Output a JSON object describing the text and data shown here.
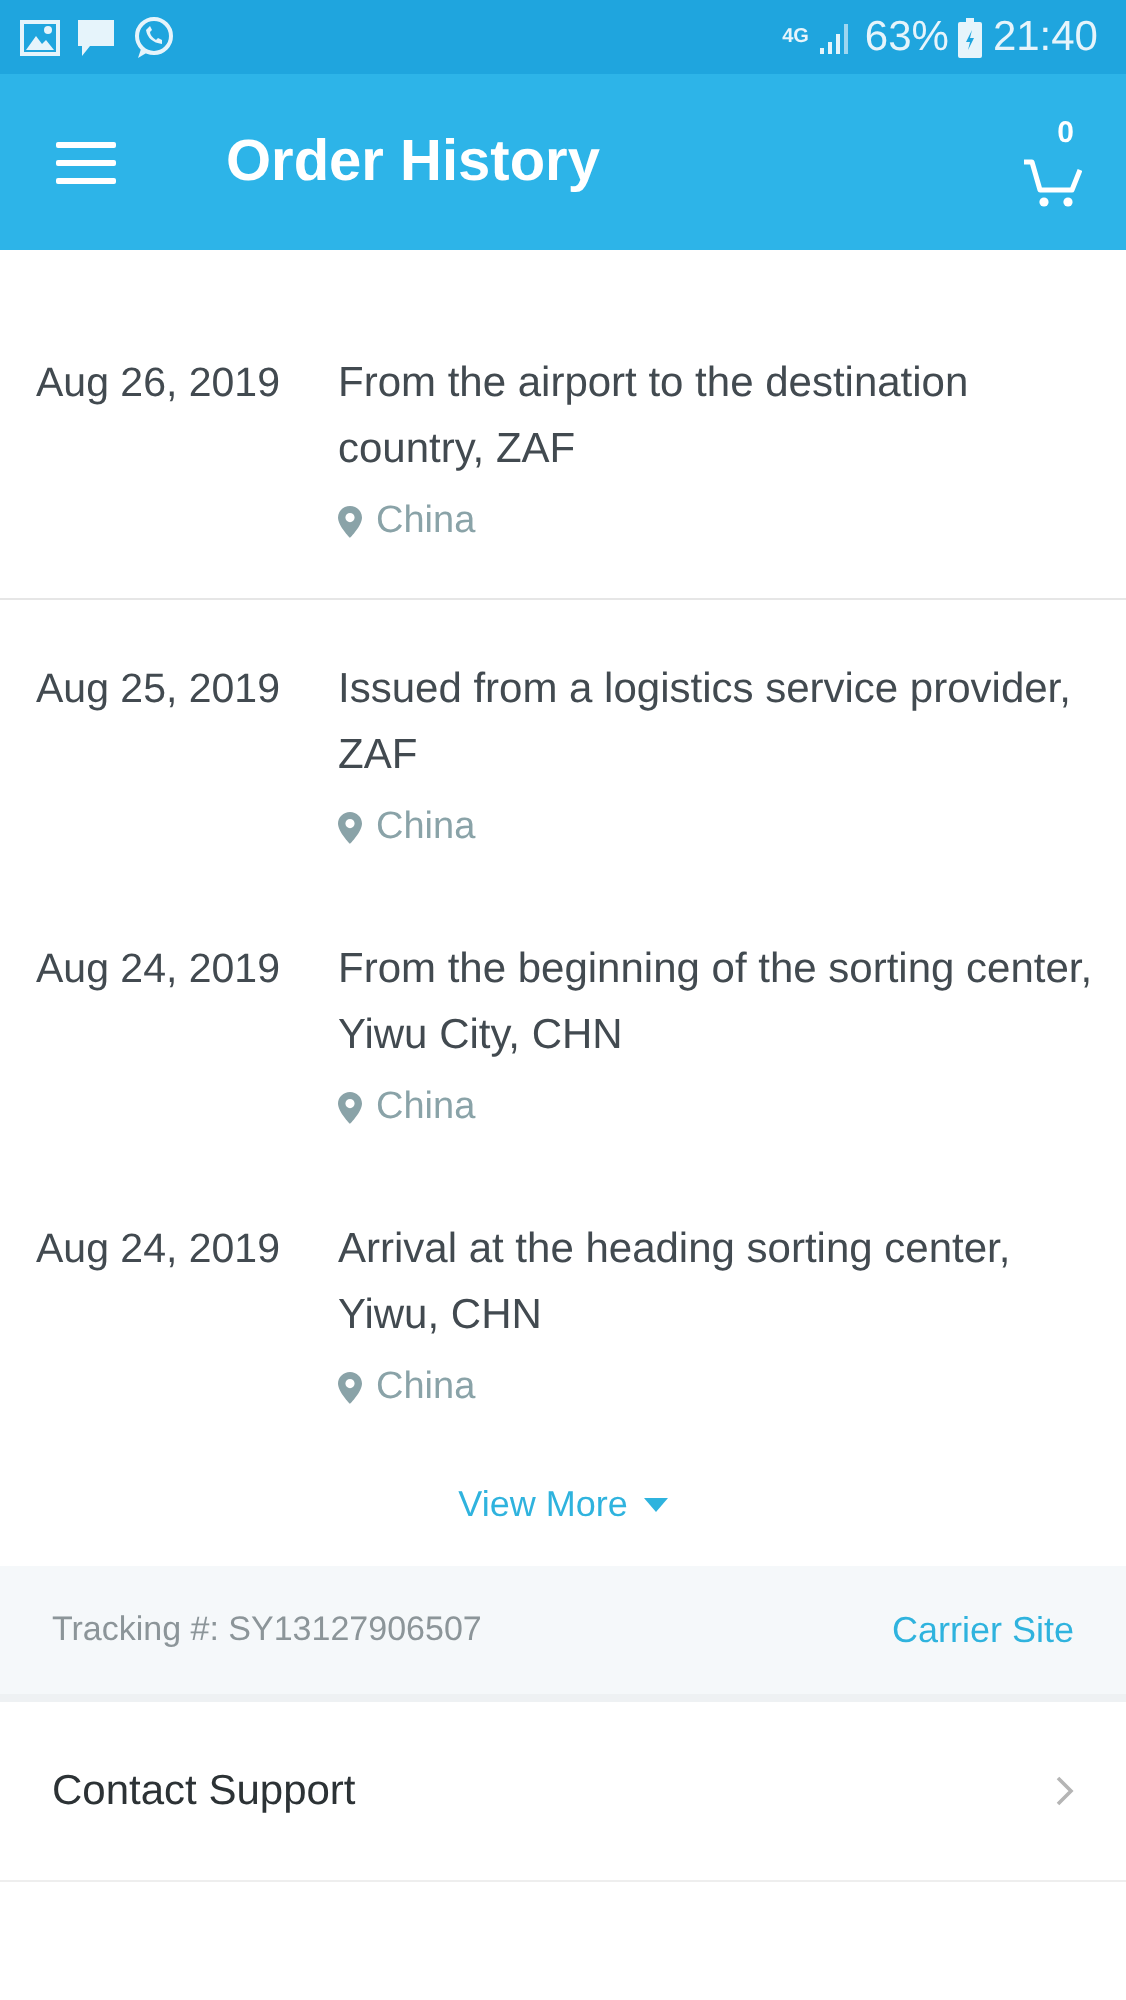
{
  "status_bar": {
    "network": "4G",
    "battery": "63%",
    "time": "21:40"
  },
  "app_bar": {
    "title": "Order History",
    "cart_count": "0"
  },
  "events": [
    {
      "date": "Aug 26, 2019",
      "description": "From the airport to the destination country, ZAF",
      "location": "China",
      "divider": true
    },
    {
      "date": "Aug 25, 2019",
      "description": "Issued from a logistics service provider, ZAF",
      "location": "China",
      "divider": false
    },
    {
      "date": "Aug 24, 2019",
      "description": "From the beginning of the sorting center, Yiwu City, CHN",
      "location": "China",
      "divider": false
    },
    {
      "date": "Aug 24, 2019",
      "description": "Arrival at the heading sorting center, Yiwu, CHN",
      "location": "China",
      "divider": false
    }
  ],
  "view_more": "View More",
  "tracking": {
    "label": "Tracking #: SY13127906507",
    "carrier_link": "Carrier Site"
  },
  "contact_support": "Contact Support"
}
